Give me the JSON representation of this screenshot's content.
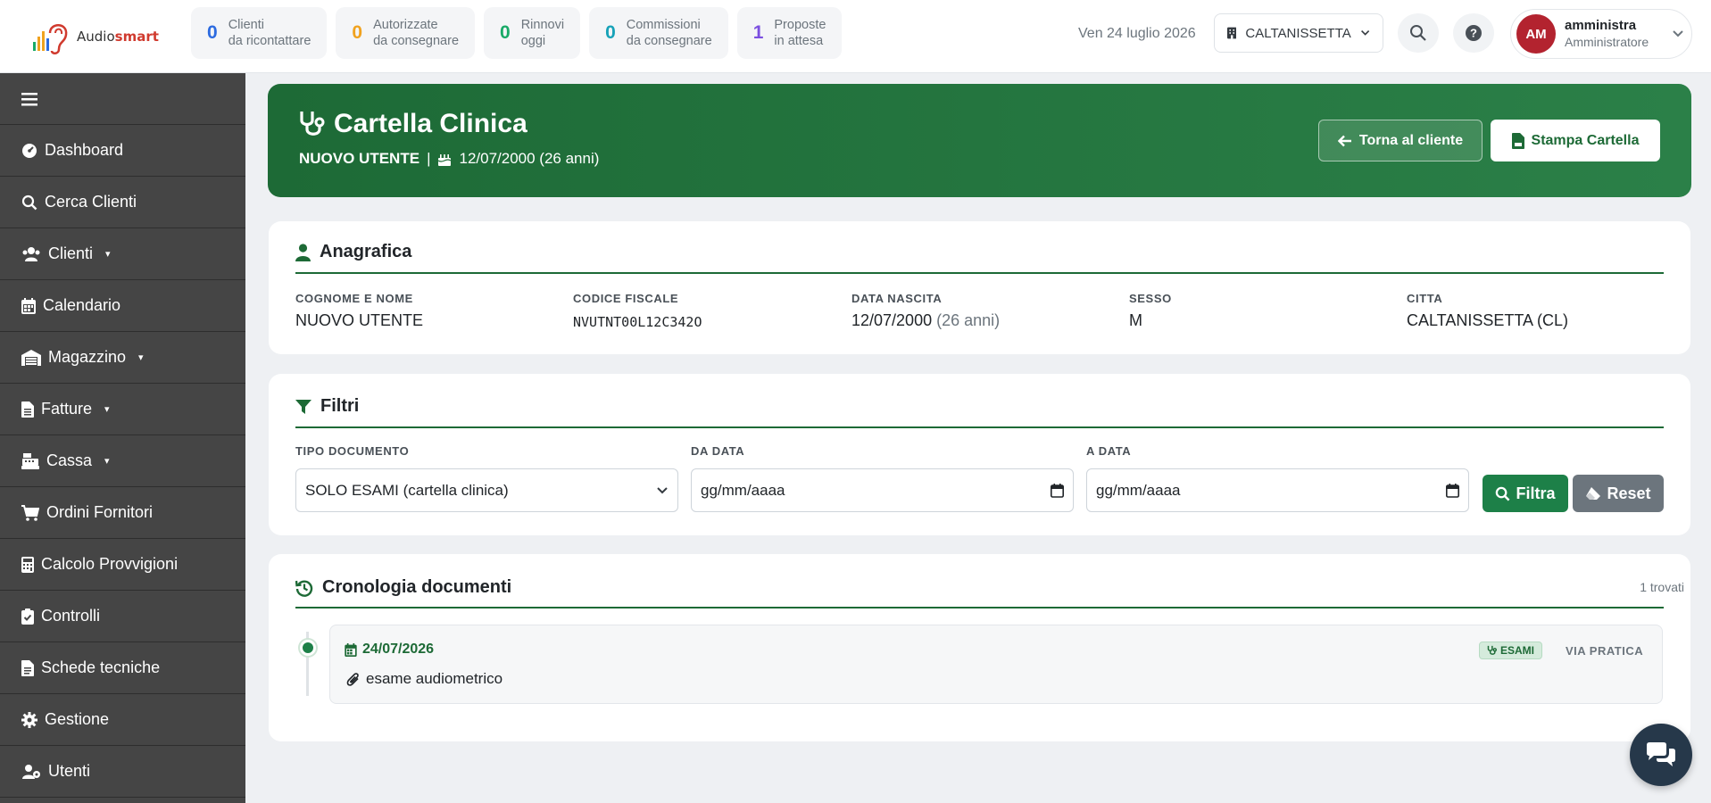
{
  "app": {
    "name_prefix": "Audio",
    "name_suffix": "smart"
  },
  "counters": [
    {
      "num": "0",
      "line1": "Clienti",
      "line2": "da ricontattare",
      "color": "#2d6be0"
    },
    {
      "num": "0",
      "line1": "Autorizzate",
      "line2": "da consegnare",
      "color": "#f0a21f"
    },
    {
      "num": "0",
      "line1": "Rinnovi",
      "line2": "oggi",
      "color": "#1aaa68"
    },
    {
      "num": "0",
      "line1": "Commissioni",
      "line2": "da consegnare",
      "color": "#17a2b8"
    },
    {
      "num": "1",
      "line1": "Proposte",
      "line2": "in attesa",
      "color": "#7b4fe0"
    }
  ],
  "header": {
    "date": "Ven 24 luglio 2026",
    "branch": "CALTANISSETTA",
    "user": {
      "initials": "AM",
      "name": "amministra",
      "role": "Amministratore"
    }
  },
  "sidebar": {
    "items": [
      {
        "label": "Dashboard",
        "icon": "gauge-icon",
        "caret": ""
      },
      {
        "label": "Cerca Clienti",
        "icon": "search-icon",
        "caret": ""
      },
      {
        "label": "Clienti",
        "icon": "users-icon",
        "caret": "▾"
      },
      {
        "label": "Calendario",
        "icon": "calendar-icon",
        "caret": ""
      },
      {
        "label": "Magazzino",
        "icon": "warehouse-icon",
        "caret": "▾"
      },
      {
        "label": "Fatture",
        "icon": "file-icon",
        "caret": "▾"
      },
      {
        "label": "Cassa",
        "icon": "cash-register-icon",
        "caret": "▾"
      },
      {
        "label": "Ordini Fornitori",
        "icon": "cart-icon",
        "caret": ""
      },
      {
        "label": "Calcolo Provvigioni",
        "icon": "calculator-icon",
        "caret": ""
      },
      {
        "label": "Controlli",
        "icon": "clipboard-check-icon",
        "caret": ""
      },
      {
        "label": "Schede tecniche",
        "icon": "file-text-icon",
        "caret": ""
      },
      {
        "label": "Gestione",
        "icon": "gear-icon",
        "caret": ""
      },
      {
        "label": "Utenti",
        "icon": "users-gear-icon",
        "caret": ""
      }
    ]
  },
  "hero": {
    "title": "Cartella Clinica",
    "patient": "NUOVO UTENTE",
    "separator": "|",
    "birth": "12/07/2000 (26 anni)",
    "back_label": "Torna al cliente",
    "print_label": "Stampa Cartella"
  },
  "anagrafica": {
    "title": "Anagrafica",
    "fields": [
      {
        "label": "COGNOME E NOME",
        "value": "NUOVO UTENTE",
        "extra": ""
      },
      {
        "label": "CODICE FISCALE",
        "value": "NVUTNT00L12C342O",
        "extra": ""
      },
      {
        "label": "DATA NASCITA",
        "value": "12/07/2000",
        "extra": "(26 anni)"
      },
      {
        "label": "SESSO",
        "value": "M",
        "extra": ""
      },
      {
        "label": "CITTA",
        "value": "CALTANISSETTA (CL)",
        "extra": ""
      }
    ]
  },
  "filtri": {
    "title": "Filtri",
    "tipo_label": "TIPO DOCUMENTO",
    "tipo_value": "SOLO ESAMI (cartella clinica)",
    "da_label": "DA DATA",
    "da_placeholder": "gg/mm/aaaa",
    "a_label": "A DATA",
    "a_placeholder": "gg/mm/aaaa",
    "filtra_label": "Filtra",
    "reset_label": "Reset"
  },
  "cronologia": {
    "title": "Cronologia documenti",
    "count": "1 trovati",
    "entries": [
      {
        "date": "24/07/2026",
        "description": "esame audiometrico",
        "badge": "ESAMI",
        "source": "VIA PRATICA"
      }
    ]
  }
}
